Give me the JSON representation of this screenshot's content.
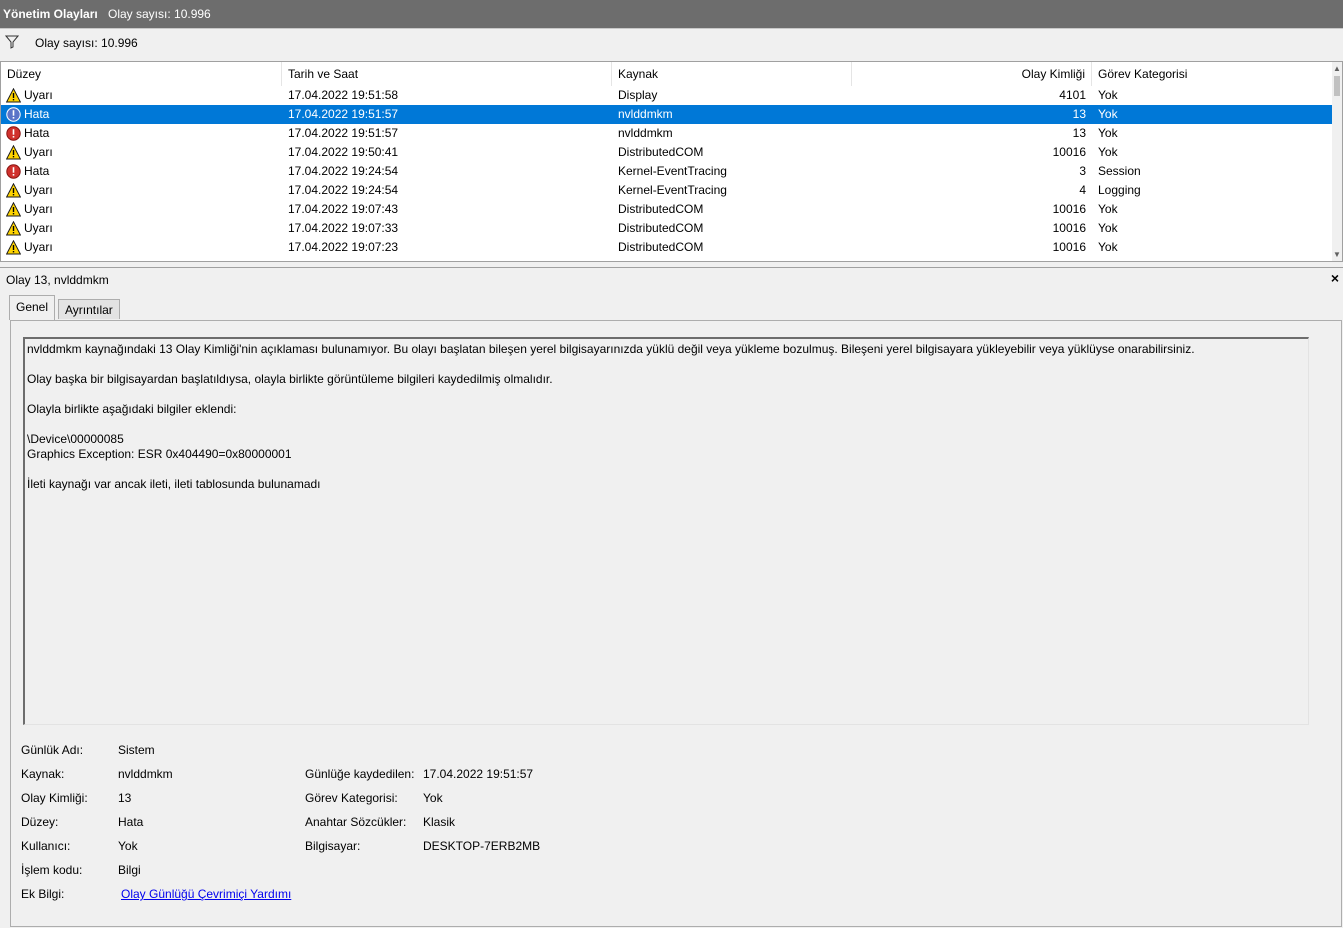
{
  "header": {
    "title": "Yönetim Olayları",
    "count": "Olay sayısı: 10.996"
  },
  "filter": {
    "count": "Olay sayısı: 10.996"
  },
  "columns": [
    "Düzey",
    "Tarih ve Saat",
    "Kaynak",
    "Olay Kimliği",
    "Görev Kategorisi"
  ],
  "rows": [
    {
      "level": "Uyarı",
      "type": "warning",
      "date": "17.04.2022 19:51:58",
      "source": "Display",
      "id": "4101",
      "category": "Yok"
    },
    {
      "level": "Hata",
      "type": "error",
      "date": "17.04.2022 19:51:57",
      "source": "nvlddmkm",
      "id": "13",
      "category": "Yok",
      "selected": true
    },
    {
      "level": "Hata",
      "type": "error",
      "date": "17.04.2022 19:51:57",
      "source": "nvlddmkm",
      "id": "13",
      "category": "Yok"
    },
    {
      "level": "Uyarı",
      "type": "warning",
      "date": "17.04.2022 19:50:41",
      "source": "DistributedCOM",
      "id": "10016",
      "category": "Yok"
    },
    {
      "level": "Hata",
      "type": "error",
      "date": "17.04.2022 19:24:54",
      "source": "Kernel-EventTracing",
      "id": "3",
      "category": "Session"
    },
    {
      "level": "Uyarı",
      "type": "warning",
      "date": "17.04.2022 19:24:54",
      "source": "Kernel-EventTracing",
      "id": "4",
      "category": "Logging"
    },
    {
      "level": "Uyarı",
      "type": "warning",
      "date": "17.04.2022 19:07:43",
      "source": "DistributedCOM",
      "id": "10016",
      "category": "Yok"
    },
    {
      "level": "Uyarı",
      "type": "warning",
      "date": "17.04.2022 19:07:33",
      "source": "DistributedCOM",
      "id": "10016",
      "category": "Yok"
    },
    {
      "level": "Uyarı",
      "type": "warning",
      "date": "17.04.2022 19:07:23",
      "source": "DistributedCOM",
      "id": "10016",
      "category": "Yok"
    }
  ],
  "detail": {
    "title": "Olay 13, nvlddmkm",
    "close": "×",
    "tabs": [
      "Genel",
      "Ayrıntılar"
    ],
    "description": [
      "nvlddmkm kaynağındaki 13 Olay Kimliği'nin açıklaması bulunamıyor. Bu olayı başlatan bileşen yerel bilgisayarınızda yüklü değil veya yükleme bozulmuş. Bileşeni yerel bilgisayara yükleyebilir veya yüklüyse onarabilirsiniz.",
      "",
      "Olay başka bir bilgisayardan başlatıldıysa, olayla birlikte görüntüleme bilgileri kaydedilmiş olmalıdır.",
      "",
      "Olayla birlikte aşağıdaki bilgiler eklendi:",
      "",
      "\\Device\\00000085",
      "Graphics Exception: ESR 0x404490=0x80000001",
      "",
      "İleti kaynağı var ancak ileti, ileti tablosunda bulunamadı"
    ],
    "props_left": [
      {
        "label": "Günlük Adı:",
        "value": "Sistem"
      },
      {
        "label": "Kaynak:",
        "value": "nvlddmkm"
      },
      {
        "label": "Olay Kimliği:",
        "value": "13"
      },
      {
        "label": "Düzey:",
        "value": "Hata"
      },
      {
        "label": "Kullanıcı:",
        "value": "Yok"
      },
      {
        "label": "İşlem kodu:",
        "value": "Bilgi"
      },
      {
        "label": "Ek Bilgi:",
        "value": "Olay Günlüğü Çevrimiçi Yardımı"
      }
    ],
    "props_right": [
      {
        "label": "Günlüğe kaydedilen:",
        "value": "17.04.2022 19:51:57"
      },
      {
        "label": "Görev Kategorisi:",
        "value": "Yok"
      },
      {
        "label": "Anahtar Sözcükler:",
        "value": "Klasik"
      },
      {
        "label": "Bilgisayar:",
        "value": "DESKTOP-7ERB2MB"
      }
    ]
  }
}
